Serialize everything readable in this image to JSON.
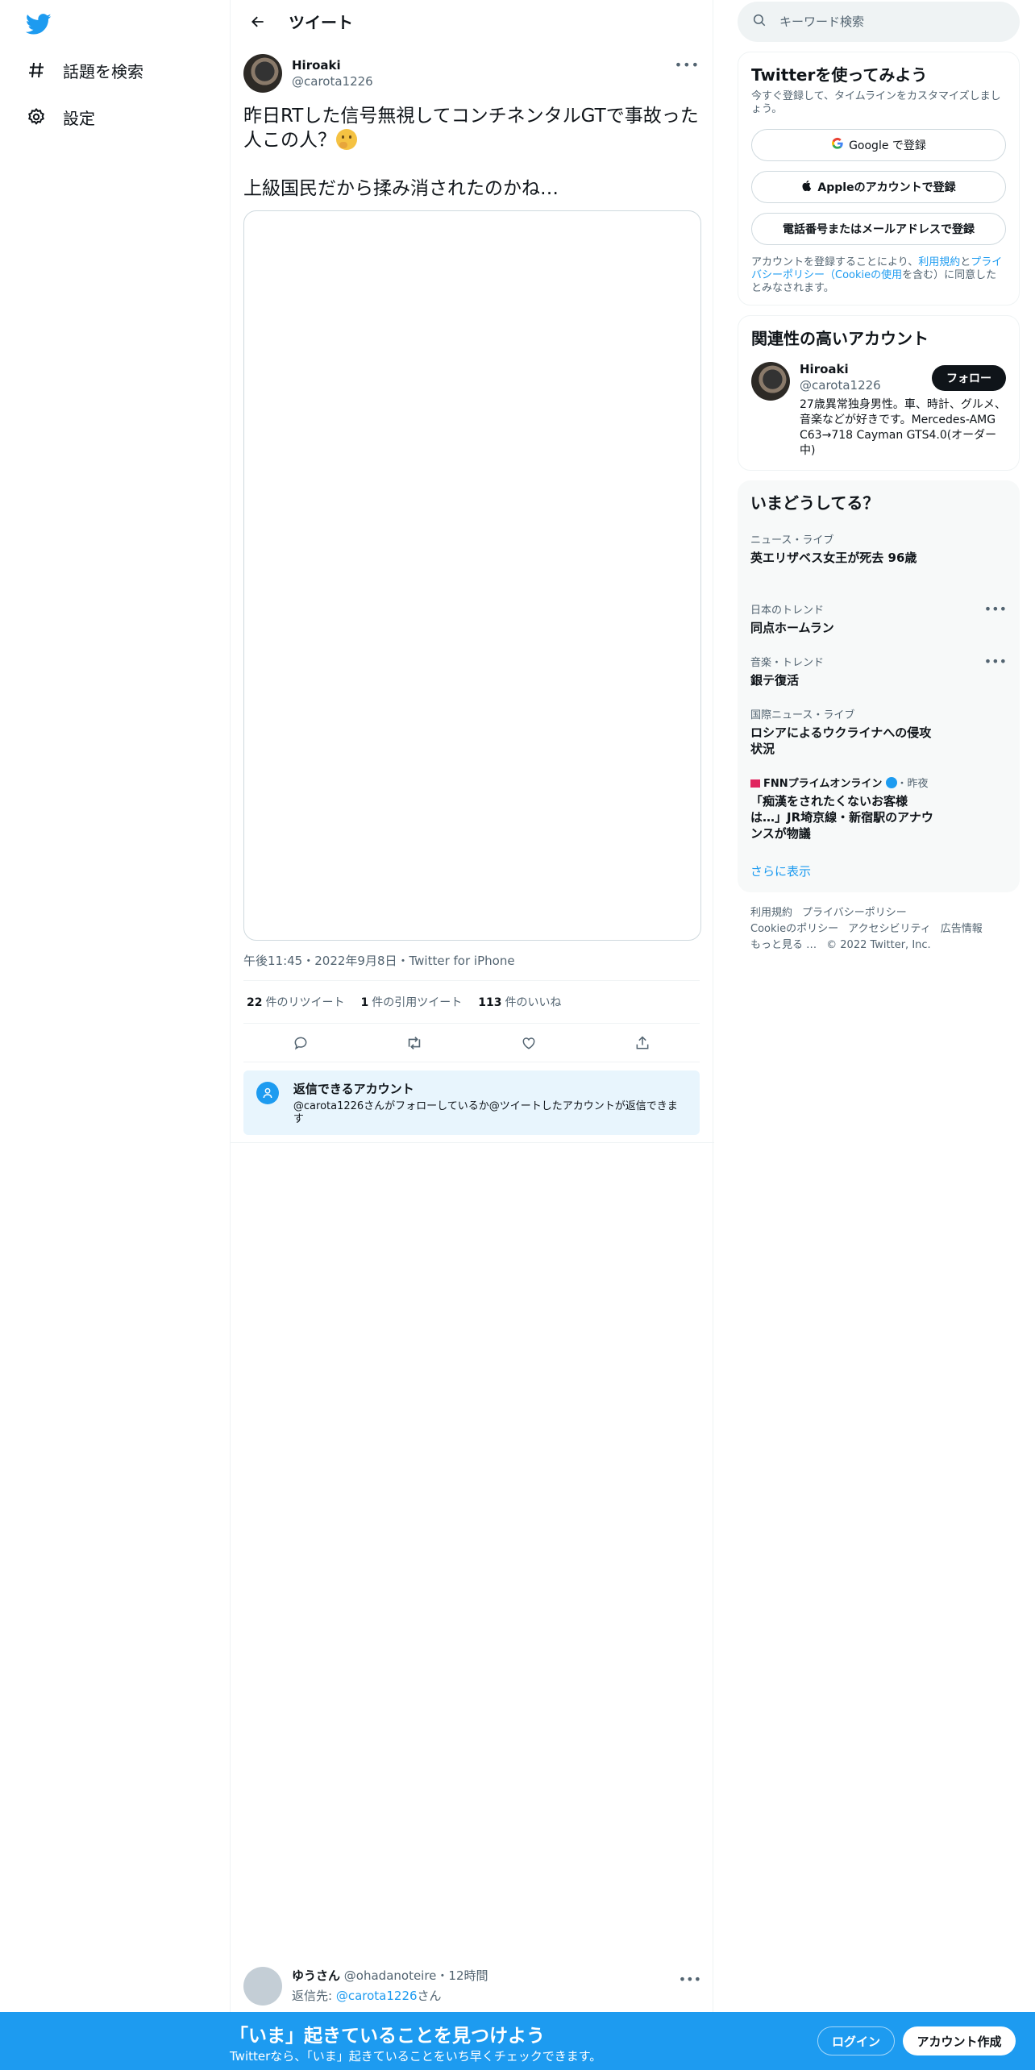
{
  "nav": {
    "explore_label": "話題を検索",
    "settings_label": "設定"
  },
  "header": {
    "title": "ツイート"
  },
  "tweet": {
    "author_name": "Hiroaki",
    "author_handle": "@carota1226",
    "text_line1": "昨日RTした信号無視してコンチネンタルGTで事故った人この人？",
    "text_line2": "上級国民だから揉み消されたのかね…",
    "timestamp": "午後11:45・2022年9月8日・Twitter for iPhone",
    "retweets_count": "22",
    "retweets_label": "件のリツイート",
    "quotes_count": "1",
    "quotes_label": "件の引用ツイート",
    "likes_count": "113",
    "likes_label": "件のいいね"
  },
  "reply_notice": {
    "title": "返信できるアカウント",
    "body": "@carota1226さんがフォローしているか@ツイートしたアカウントが返信できます"
  },
  "reply": {
    "name": "ゆうさん",
    "handle": "@ohadanoteire・12時間",
    "reply_to_prefix": "返信先: ",
    "reply_to_mention": "@carota1226",
    "reply_to_suffix": "さん"
  },
  "search": {
    "placeholder": "キーワード検索"
  },
  "signup_card": {
    "title": "Twitterを使ってみよう",
    "subtitle": "今すぐ登録して、タイムラインをカスタマイズしましょう。",
    "google_label": "Google で登録",
    "apple_label": "Appleのアカウントで登録",
    "phone_label": "電話番号またはメールアドレスで登録",
    "legal_prefix": "アカウントを登録することにより、",
    "legal_terms": "利用規約",
    "legal_and": "と",
    "legal_privacy": "プライバシーポリシー（Cookieの使用",
    "legal_suffix": "を含む）に同意したとみなされます。"
  },
  "related": {
    "title": "関連性の高いアカウント",
    "name": "Hiroaki",
    "handle": "@carota1226",
    "follow_label": "フォロー",
    "bio": "27歳異常独身男性。車、時計、グルメ、音楽などが好きです。Mercedes-AMG C63→718 Cayman GTS4.0(オーダー中)"
  },
  "trends": {
    "title": "いまどうしてる？",
    "items": [
      {
        "context": "ニュース・ライブ",
        "title": "英エリザベス女王が死去 96歳"
      },
      {
        "context": "日本のトレンド",
        "title": "同点ホームラン"
      },
      {
        "context": "音楽・トレンド",
        "title": "銀テ復活"
      },
      {
        "context": "国際ニュース・ライブ",
        "title": "ロシアによるウクライナへの侵攻状況"
      },
      {
        "context_source": "FNNプライムオンライン",
        "context_time": "・昨夜",
        "title": "「痴漢をされたくないお客様は…」JR埼京線・新宿駅のアナウンスが物議"
      }
    ],
    "show_more": "さらに表示"
  },
  "footer": {
    "terms": "利用規約",
    "privacy": "プライバシーポリシー",
    "cookie": "Cookieのポリシー",
    "accessibility": "アクセシビリティ",
    "ads": "広告情報",
    "more": "もっと見る …",
    "copyright": "© 2022 Twitter, Inc."
  },
  "bottom_bar": {
    "title": "「いま」起きていることを見つけよう",
    "subtitle": "Twitterなら、「いま」起きていることをいち早くチェックできます。",
    "login_label": "ログイン",
    "signup_label": "アカウント作成"
  },
  "colors": {
    "accent": "#1d9bf0",
    "text": "#0f1419",
    "muted": "#536471"
  }
}
